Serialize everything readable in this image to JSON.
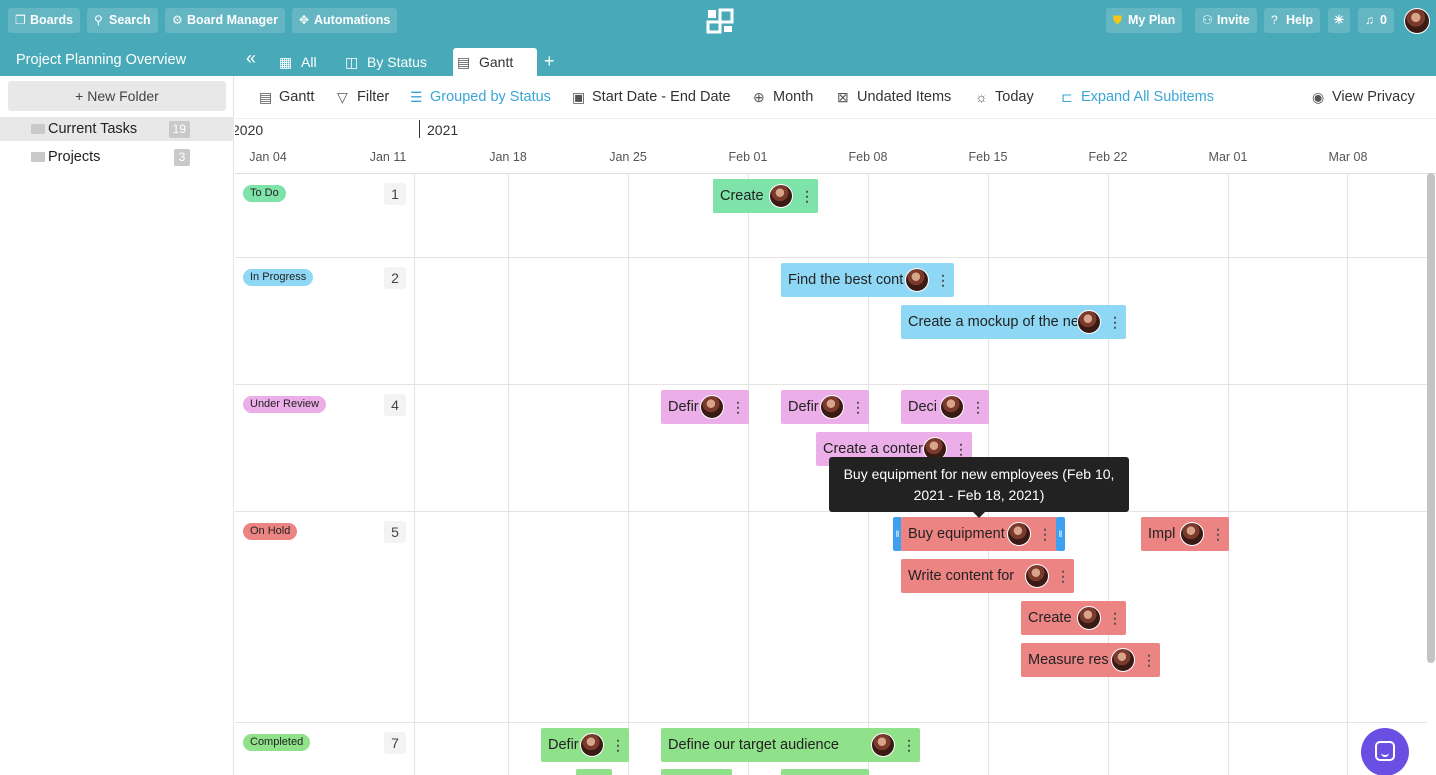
{
  "topbar": {
    "boards": "Boards",
    "search": "Search",
    "board_manager": "Board Manager",
    "automations": "Automations",
    "my_plan": "My Plan",
    "invite": "Invite",
    "help": "Help",
    "notifications": "0"
  },
  "tabbar": {
    "project_title": "Project Planning Overview",
    "tabs": [
      {
        "label": "All",
        "icon": "table-icon"
      },
      {
        "label": "By Status",
        "icon": "kanban-icon"
      },
      {
        "label": "Gantt",
        "icon": "gantt-icon",
        "active": true
      }
    ]
  },
  "sidebar": {
    "new_folder": "+ New Folder",
    "folders": [
      {
        "name": "Current Tasks",
        "count": "19",
        "selected": true
      },
      {
        "name": "Projects",
        "count": "3",
        "selected": false
      }
    ]
  },
  "toolbar": {
    "gantt": "Gantt",
    "filter": "Filter",
    "grouped": "Grouped by Status",
    "dates": "Start Date - End Date",
    "month": "Month",
    "undated": "Undated Items",
    "today": "Today",
    "expand": "Expand All Subitems",
    "privacy": "View Privacy"
  },
  "timeline": {
    "years": [
      "2020",
      "2021"
    ],
    "dates": [
      "Jan 04",
      "Jan 11",
      "Jan 18",
      "Jan 25",
      "Feb 01",
      "Feb 08",
      "Feb 15",
      "Feb 22",
      "Mar 01",
      "Mar 08"
    ]
  },
  "groups": [
    {
      "status": "To Do",
      "count": "1"
    },
    {
      "status": "In Progress",
      "count": "2"
    },
    {
      "status": "Under Review",
      "count": "4"
    },
    {
      "status": "On Hold",
      "count": "5"
    },
    {
      "status": "Completed",
      "count": "7"
    }
  ],
  "bars": {
    "todo_1": "Create",
    "inprog_1": "Find the best cont",
    "inprog_2": "Create a mockup of the ne",
    "review_1": "Defir",
    "review_2": "Defir",
    "review_3": "Deci",
    "review_4": "Create a conter",
    "hold_1": "Buy equipment",
    "hold_2": "Impl",
    "hold_3": "Write content for",
    "hold_4": "Create",
    "hold_5": "Measure res",
    "done_1": "Defir",
    "done_2": "Define our target audience"
  },
  "tooltip": {
    "text": "Buy equipment for new employees (Feb 10, 2021 - Feb 18, 2021)"
  },
  "colors": {
    "brand": "#48aab8",
    "todo": "#7de3a8",
    "in_progress": "#8fd8f5",
    "under_review": "#ecaee8",
    "on_hold": "#ec8484",
    "completed": "#8fe18a",
    "accent": "#3aa6d6"
  }
}
